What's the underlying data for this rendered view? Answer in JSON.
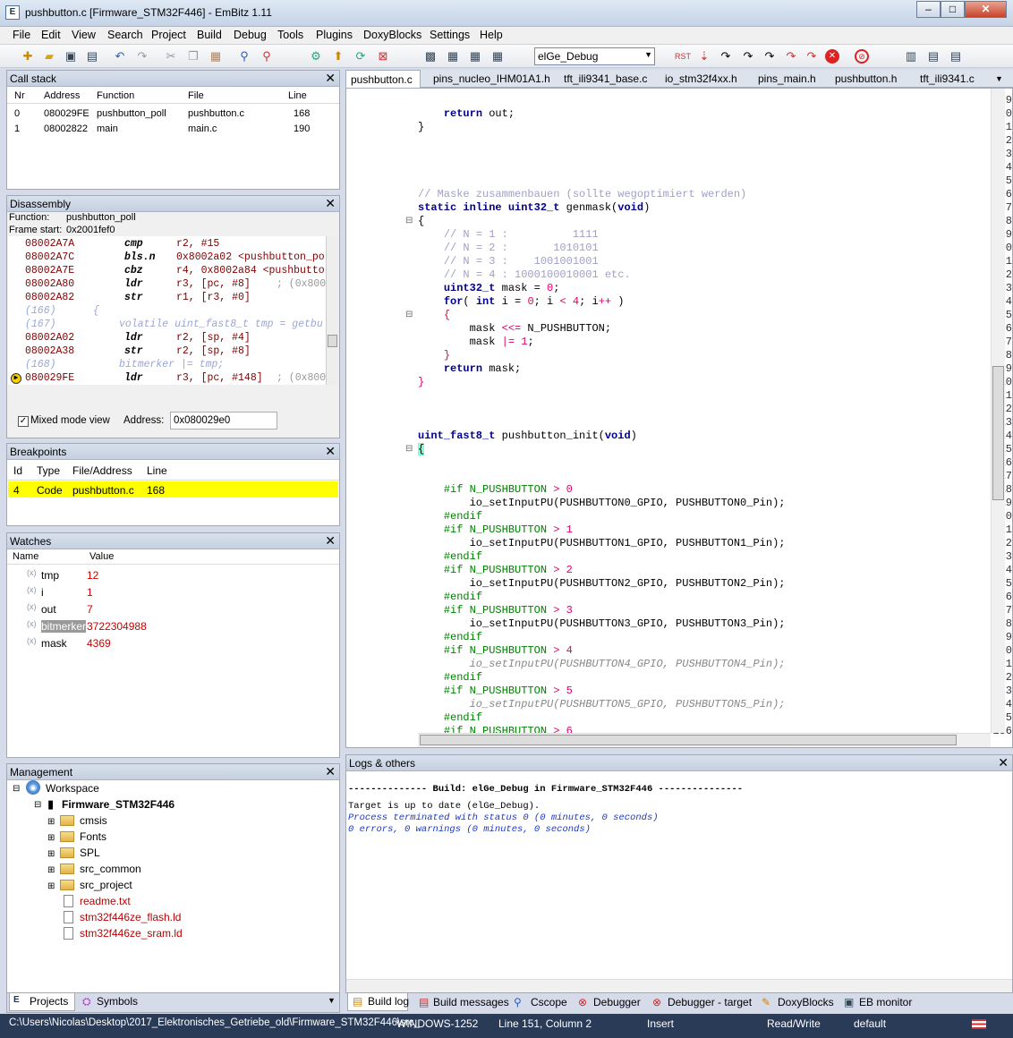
{
  "window": {
    "title": "pushbutton.c [Firmware_STM32F446] - EmBitz 1.11",
    "min": "–",
    "max": "□",
    "close": "✕"
  },
  "menu": [
    "File",
    "Edit",
    "View",
    "Search",
    "Project",
    "Build",
    "Debug",
    "Tools",
    "Plugins",
    "DoxyBlocks",
    "Settings",
    "Help"
  ],
  "toolbar": {
    "build_target": "elGe_Debug"
  },
  "callstack": {
    "title": "Call stack",
    "headers": [
      "Nr",
      "Address",
      "Function",
      "File",
      "Line"
    ],
    "rows": [
      [
        "0",
        "080029FE",
        "pushbutton_poll",
        "pushbutton.c",
        "168"
      ],
      [
        "1",
        "08002822",
        "main",
        "main.c",
        "190"
      ]
    ]
  },
  "disassembly": {
    "title": "Disassembly",
    "function_label": "Function:",
    "function": "pushbutton_poll",
    "frame_label": "Frame start:",
    "frame": "0x2001fef0",
    "lines": [
      [
        "08002A7A",
        "cmp",
        "r2, #15",
        ""
      ],
      [
        "08002A7C",
        "bls.n",
        "0x8002a02 <pushbutton_po",
        ""
      ],
      [
        "08002A7E",
        "cbz",
        "r4, 0x8002a84 <pushbutto",
        ""
      ],
      [
        "08002A80",
        "ldr",
        "r3, [pc, #8]",
        "; (0x800"
      ],
      [
        "08002A82",
        "str",
        "r1, [r3, #0]",
        ""
      ],
      [
        "(166)",
        "{",
        "",
        ""
      ],
      [
        "(167)",
        "volatile uint_fast8_t tmp = getbu",
        "",
        ""
      ],
      [
        "08002A02",
        "ldr",
        "r2, [sp, #4]",
        ""
      ],
      [
        "08002A38",
        "str",
        "r2, [sp, #8]",
        ""
      ],
      [
        "(168)",
        "bitmerker |= tmp;",
        "",
        ""
      ],
      [
        "080029FE",
        "ldr",
        "r3, [pc, #148]",
        "; (0x800"
      ]
    ],
    "mixed_label": "Mixed mode view",
    "address_label": "Address:",
    "address": "0x080029e0"
  },
  "breakpoints": {
    "title": "Breakpoints",
    "headers": [
      "Id",
      "Type",
      "File/Address",
      "Line"
    ],
    "row": [
      "4",
      "Code",
      "pushbutton.c",
      "168"
    ]
  },
  "watches": {
    "title": "Watches",
    "headers": [
      "Name",
      "Value"
    ],
    "rows": [
      [
        "tmp",
        "12"
      ],
      [
        "i",
        "1"
      ],
      [
        "out",
        "7"
      ],
      [
        "bitmerker",
        "3722304988"
      ],
      [
        "mask",
        "4369"
      ]
    ]
  },
  "management": {
    "title": "Management",
    "workspace": "Workspace",
    "project": "Firmware_STM32F446",
    "folders": [
      "cmsis",
      "Fonts",
      "SPL",
      "src_common",
      "src_project"
    ],
    "files": [
      "readme.txt",
      "stm32f446ze_flash.ld",
      "stm32f446ze_sram.ld"
    ],
    "tabs": [
      "Projects",
      "Symbols"
    ]
  },
  "editor": {
    "tabs": [
      "pushbutton.c",
      "pins_nucleo_IHM01A1.h",
      "tft_ili9341_base.c",
      "io_stm32f4xx.h",
      "pins_main.h",
      "pushbutton.h",
      "tft_ili9341.c"
    ]
  },
  "logs": {
    "title": "Logs & others",
    "lines": [
      "-------------- Build: elGe_Debug in Firmware_STM32F446 ---------------",
      "Target is up to date (elGe_Debug).",
      "Process terminated with status 0 (0 minutes, 0 seconds)",
      "0 errors, 0 warnings (0 minutes, 0 seconds)"
    ],
    "tabs": [
      "Build log",
      "Build messages",
      "Cscope",
      "Debugger",
      "Debugger - target",
      "DoxyBlocks",
      "EB monitor"
    ]
  },
  "status": {
    "path": "C:\\Users\\Nicolas\\Desktop\\2017_Elektronisches_Getriebe_old\\Firmware_STM32F446\\src_",
    "encoding": "WINDOWS-1252",
    "position": "Line 151, Column 2",
    "mode": "Insert",
    "access": "Read/Write",
    "lang": "default"
  }
}
